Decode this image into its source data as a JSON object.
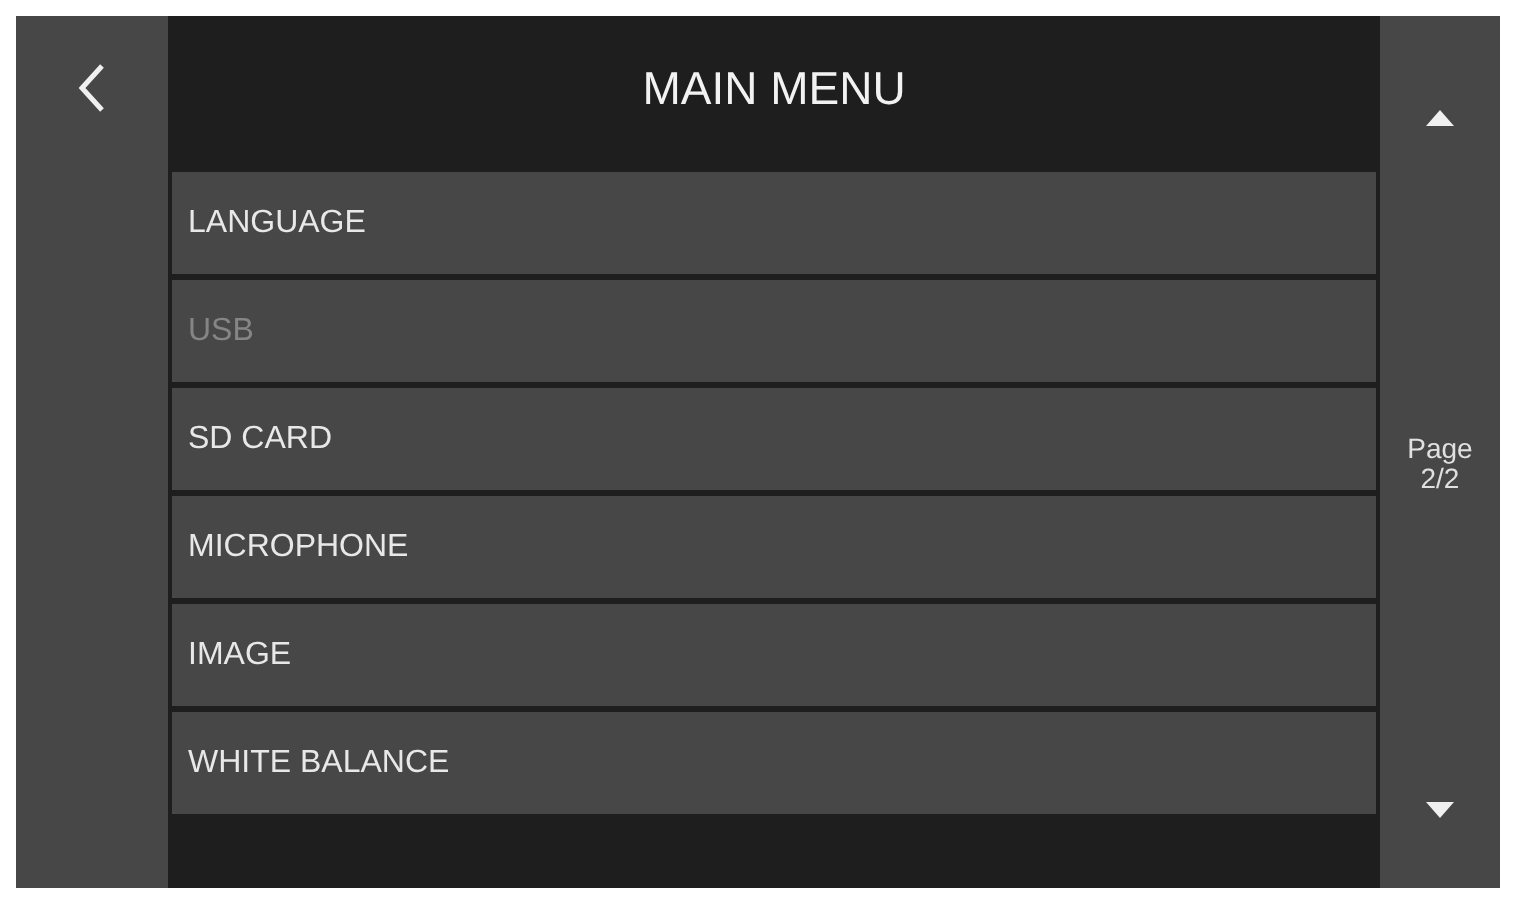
{
  "title": "MAIN MENU",
  "items": [
    {
      "label": "LANGUAGE",
      "disabled": false
    },
    {
      "label": "USB",
      "disabled": true
    },
    {
      "label": "SD CARD",
      "disabled": false
    },
    {
      "label": "MICROPHONE",
      "disabled": false
    },
    {
      "label": "IMAGE",
      "disabled": false
    },
    {
      "label": "WHITE BALANCE",
      "disabled": false
    }
  ],
  "page": {
    "label": "Page",
    "value": "2/2"
  }
}
